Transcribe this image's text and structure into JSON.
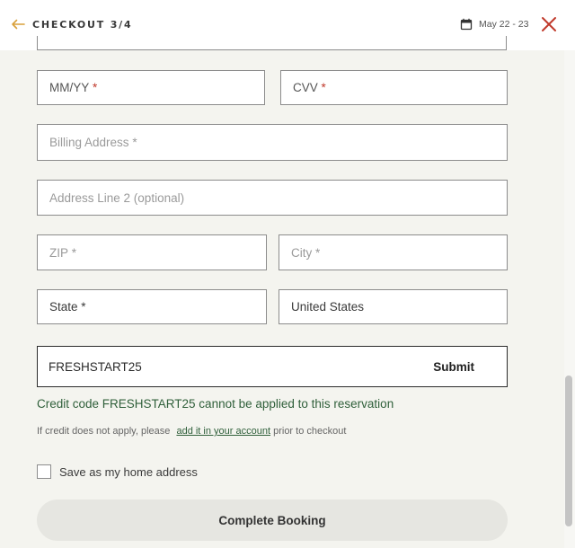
{
  "header": {
    "back_icon": "arrow-left-icon",
    "step_label": "CHECKOUT 3/4",
    "calendar_icon": "calendar-icon",
    "date_range": "May 22 - 23",
    "close_icon": "close-icon",
    "accent_color": "#d9a13b",
    "close_color": "#c0392b"
  },
  "form": {
    "expiry_placeholder": "MM/YY",
    "cvv_placeholder": "CVV",
    "billing_address_placeholder": "Billing Address",
    "address_line2_placeholder": "Address Line 2 (optional)",
    "zip_placeholder": "ZIP",
    "city_placeholder": "City",
    "state_placeholder": "State",
    "country_value": "United States",
    "required_marker": "*"
  },
  "credit": {
    "code_value": "FRESHSTART25",
    "submit_label": "Submit",
    "error_message": "Credit code FRESHSTART25 cannot be applied to this reservation",
    "note_prefix": "If credit does not apply, please",
    "note_link": "add it in your account",
    "note_suffix": "prior to checkout",
    "error_color": "#2f5f3a"
  },
  "save_home": {
    "label": "Save as my home address",
    "checked": false
  },
  "actions": {
    "complete_label": "Complete Booking"
  }
}
